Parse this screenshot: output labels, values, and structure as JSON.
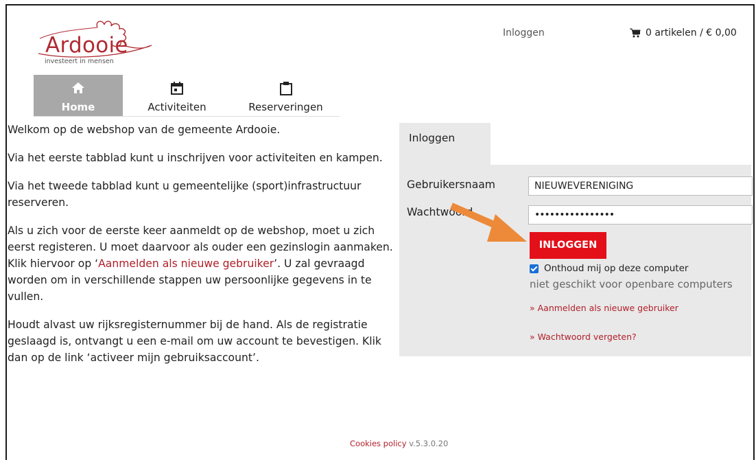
{
  "logo": {
    "word": "Ardooie",
    "tagline": "investeert in mensen",
    "color": "#b02a32"
  },
  "header": {
    "login_link": "Inloggen",
    "cart": "0 artikelen / € 0,00",
    "cart_icon": "cart-icon"
  },
  "nav": {
    "items": [
      {
        "label": "Home",
        "icon": "home-icon",
        "active": true
      },
      {
        "label": "Activiteiten",
        "icon": "calendar-icon"
      },
      {
        "label": "Reserveringen",
        "icon": "clipboard-icon"
      }
    ]
  },
  "intro": {
    "p1": "Welkom op de webshop van de gemeente Ardooie.",
    "p2": "Via het eerste tabblad kunt u inschrijven voor activiteiten en kampen.",
    "p3": "Via het tweede tabblad kunt u gemeentelijke (sport)infrastructuur reserveren.",
    "p4_before": "Als u zich voor de eerste keer aanmeldt op de webshop, moet u zich eerst registeren. U moet daarvoor als ouder een gezinslogin aanmaken. Klik hiervoor op ‘",
    "p4_link": "Aanmelden als nieuwe gebruiker",
    "p4_after": "’. U zal gevraagd worden om in verschillende stappen uw persoonlijke gegevens in te vullen.",
    "p5": "Houdt alvast uw rijksregisternummer bij de hand. Als de registratie geslaagd is, ontvangt u een e-mail om uw account te bevestigen. Klik dan op de link ‘activeer mijn gebruiksaccount’."
  },
  "login": {
    "tab": "Inloggen",
    "username_label": "Gebruikersnaam",
    "username_value": "NIEUWEVERENIGING",
    "password_label": "Wachtwoord",
    "password_value": "••••••••••••••••",
    "button": "INLOGGEN",
    "remember": "Onthoud mij op deze computer",
    "remember_checked": true,
    "not_public": "niet geschikt voor openbare computers",
    "register_link": "» Aanmelden als nieuwe gebruiker",
    "forgot_link": "» Wachtwoord vergeten?",
    "button_color": "#e3101a"
  },
  "annotation": {
    "arrow_color": "#ec8a3a"
  },
  "footer": {
    "cookies": "Cookies policy",
    "version": " v.5.3.0.20"
  }
}
